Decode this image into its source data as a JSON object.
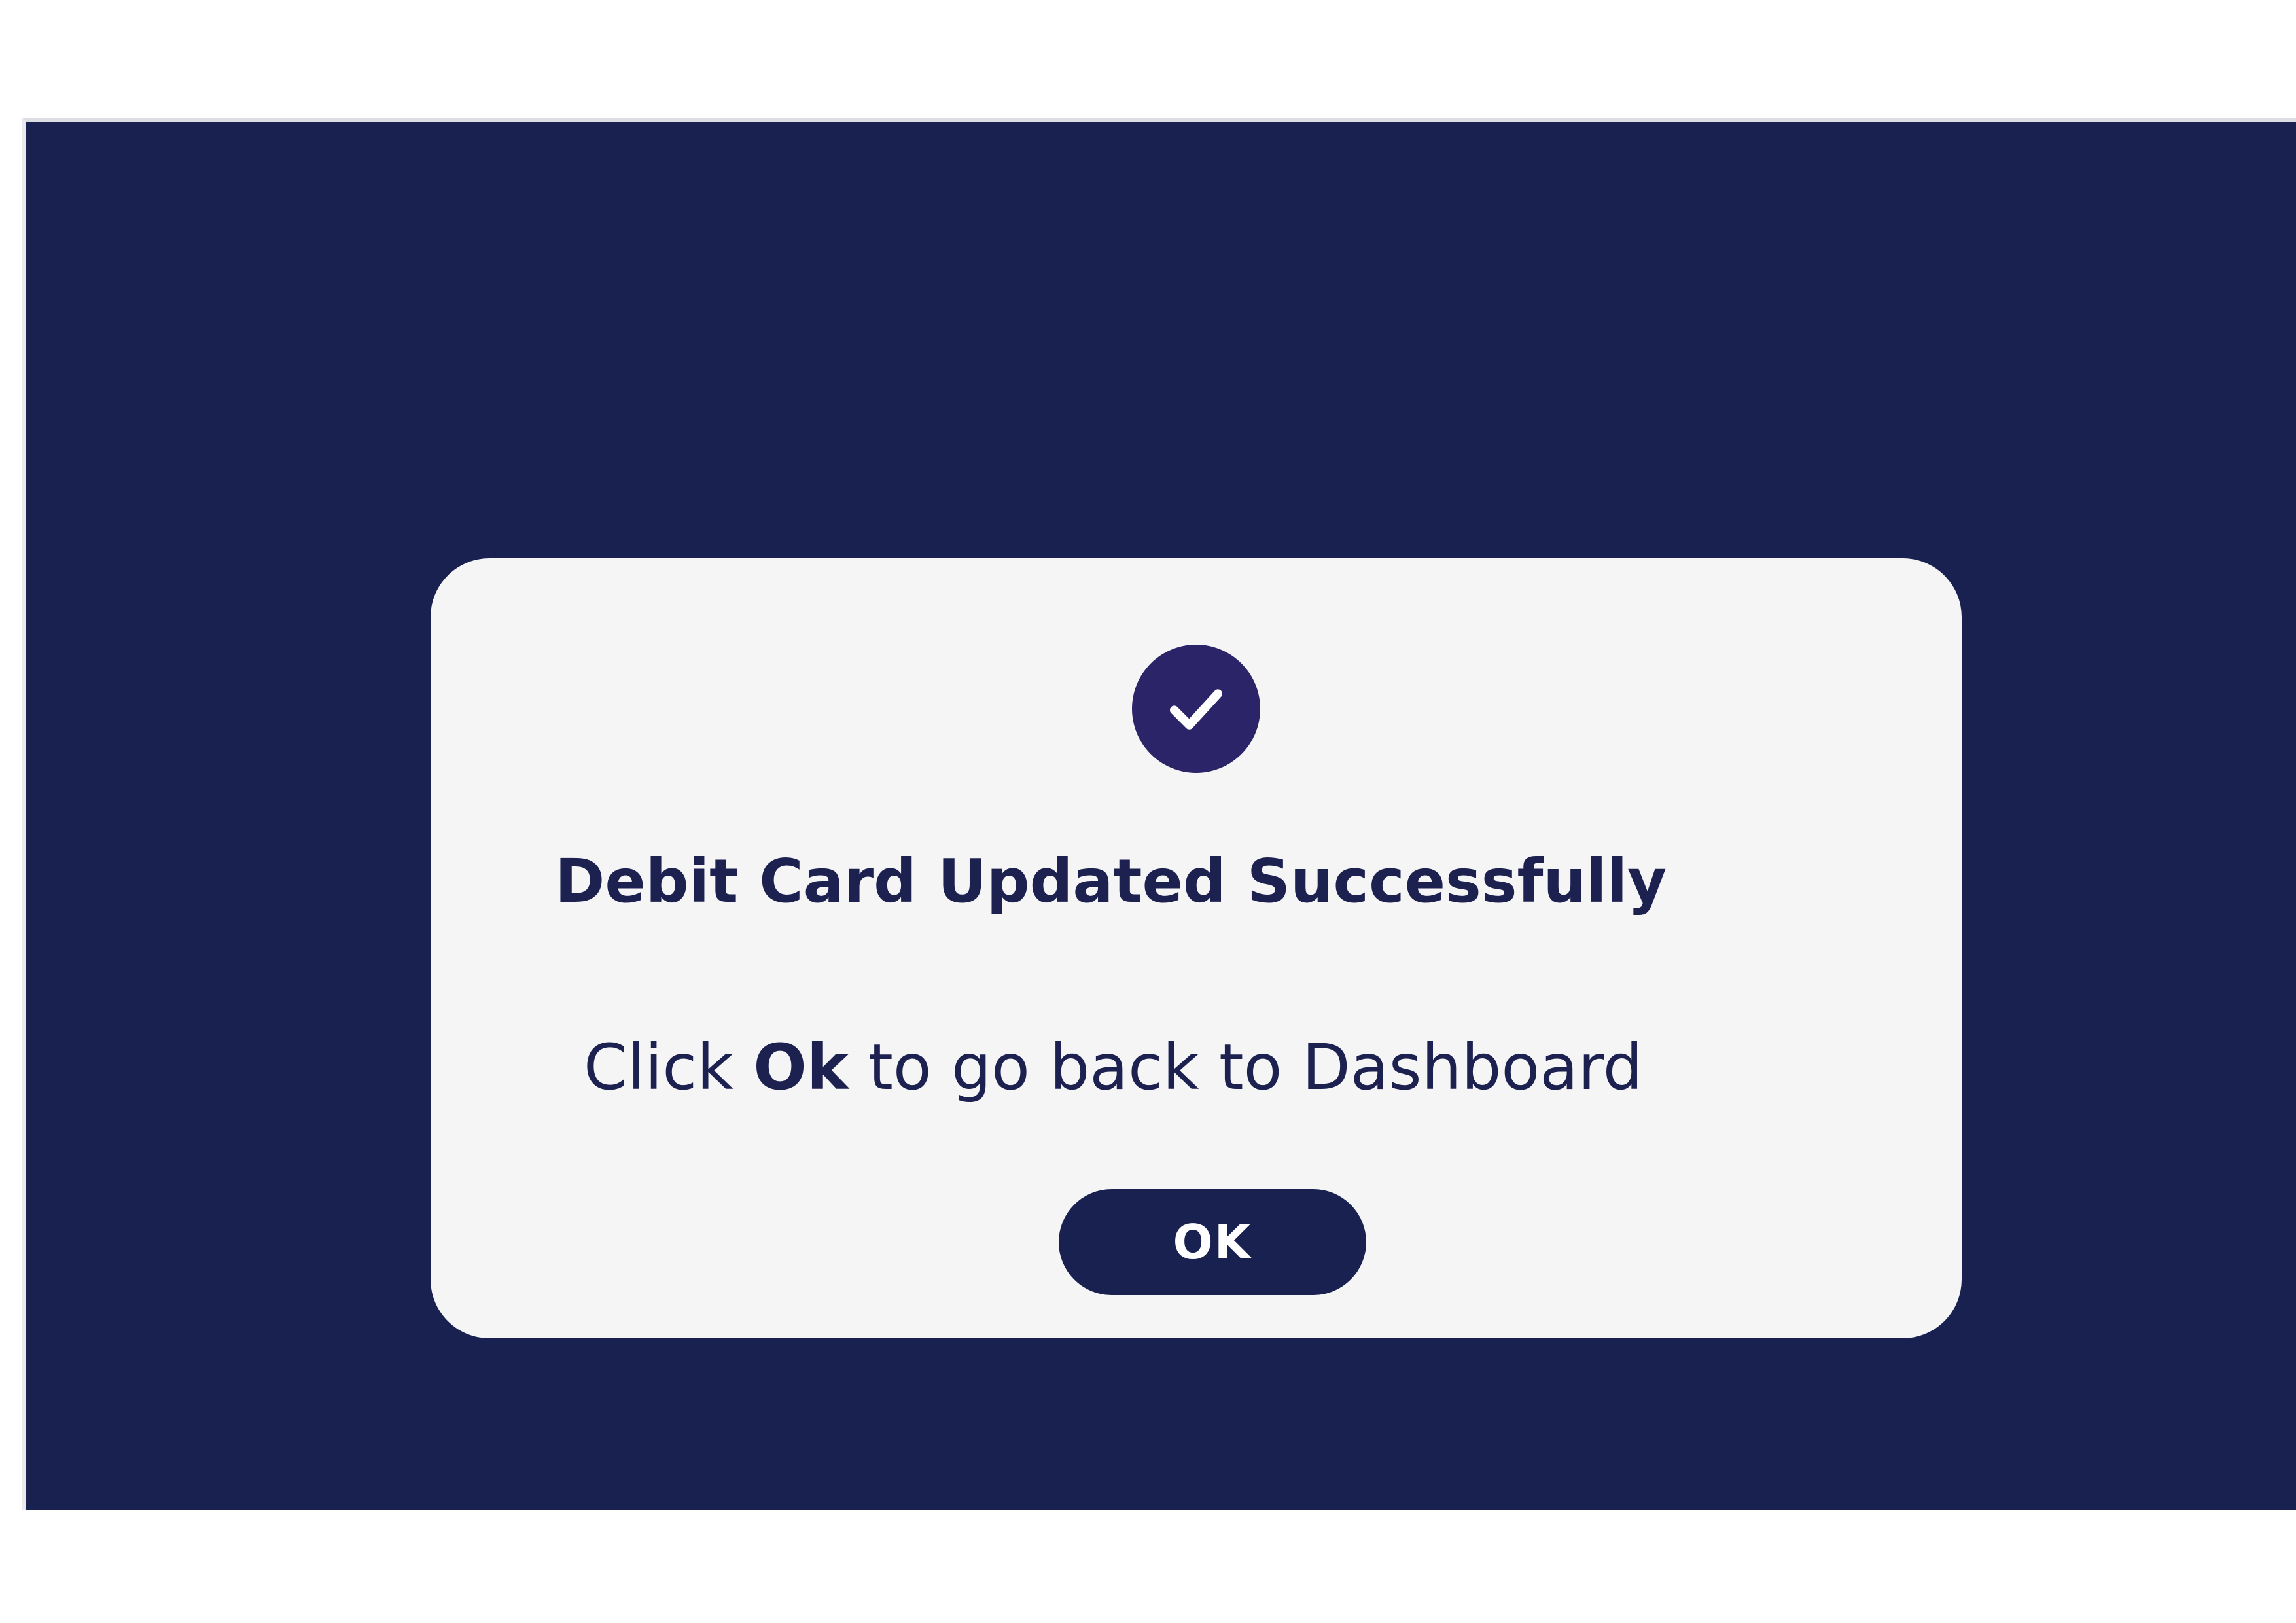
{
  "colors": {
    "background": "#192151",
    "dialog": "#f5f5f6",
    "accent": "#2c2468",
    "text": "#1c2150",
    "button_text": "#ffffff"
  },
  "dialog": {
    "icon": "checkmark-circle-icon",
    "title": "Debit Card Updated Successfully",
    "message": {
      "before": "Click ",
      "emphasis": "Ok",
      "after": " to go back to Dashboard"
    },
    "ok_label": "OK"
  }
}
